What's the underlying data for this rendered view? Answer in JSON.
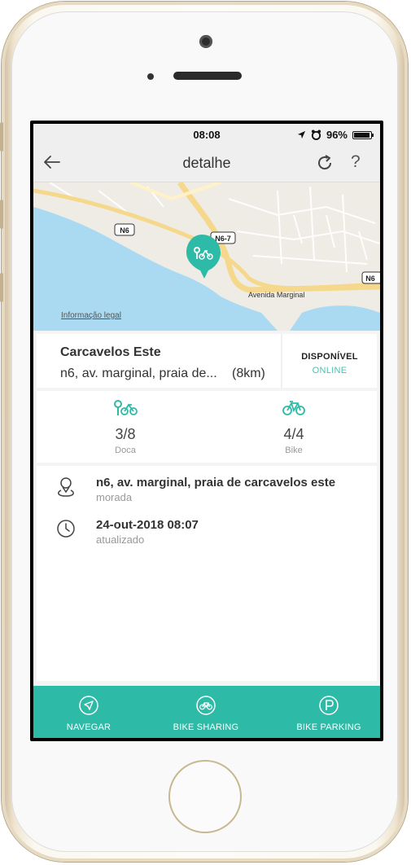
{
  "status_bar": {
    "time": "08:08",
    "battery": "96%"
  },
  "navbar": {
    "title": "detalhe",
    "help": "?"
  },
  "map": {
    "labels": {
      "n6_left": "N6",
      "n6_7": "N6-7",
      "n6_right": "N6",
      "road": "Avenida Marginal"
    },
    "legal": "Informação legal"
  },
  "station": {
    "name": "Carcavelos Este",
    "address": "n6, av. marginal, praia de...",
    "distance": "(8km)",
    "status": "DISPONÍVEL",
    "online": "ONLINE"
  },
  "availability": {
    "dock": {
      "count": "3/8",
      "label": "Doca"
    },
    "bike": {
      "count": "4/4",
      "label": "Bike"
    }
  },
  "details": {
    "address": {
      "value": "n6, av. marginal, praia de carcavelos este",
      "label": "morada"
    },
    "updated": {
      "value": "24-out-2018 08:07",
      "label": "atualizado"
    }
  },
  "tabs": {
    "navigate": "NAVEGAR",
    "bike_sharing": "BIKE SHARING",
    "bike_parking": "BIKE PARKING"
  },
  "colors": {
    "accent": "#2dbaa6",
    "online": "#47c3b2",
    "sea": "#aadaf2"
  }
}
